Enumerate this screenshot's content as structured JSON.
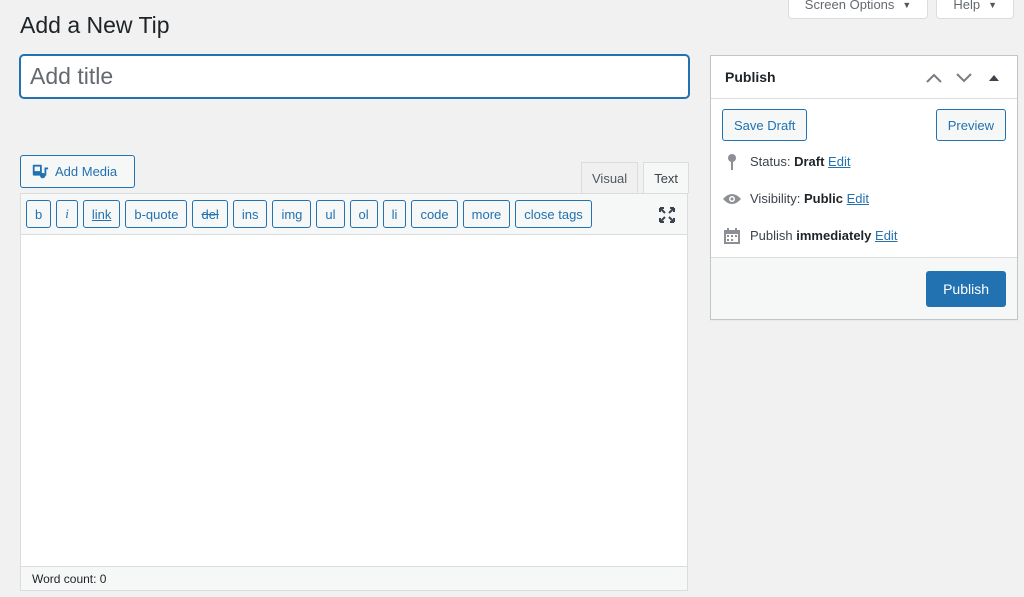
{
  "screen_meta": {
    "screen_options_label": "Screen Options",
    "help_label": "Help",
    "caret": "▼"
  },
  "page": {
    "title": "Add a New Tip"
  },
  "title_field": {
    "placeholder": "Add title",
    "value": ""
  },
  "editor": {
    "add_media_label": "Add Media",
    "tabs": [
      {
        "label": "Visual",
        "active": false
      },
      {
        "label": "Text",
        "active": true
      }
    ],
    "toolbar_buttons": [
      "b",
      "i",
      "link",
      "b-quote",
      "del",
      "ins",
      "img",
      "ul",
      "ol",
      "li",
      "code",
      "more",
      "close tags"
    ],
    "content": "",
    "word_count_label": "Word count: 0"
  },
  "publish_box": {
    "heading": "Publish",
    "save_draft_label": "Save Draft",
    "preview_label": "Preview",
    "status": {
      "label": "Status: ",
      "value": "Draft",
      "edit": "Edit"
    },
    "visibility": {
      "label": "Visibility: ",
      "value": "Public",
      "edit": "Edit"
    },
    "schedule": {
      "label": "Publish ",
      "value": "immediately",
      "edit": "Edit"
    },
    "publish_label": "Publish"
  },
  "colors": {
    "accent": "#2271b1",
    "background": "#f1f1f1"
  }
}
